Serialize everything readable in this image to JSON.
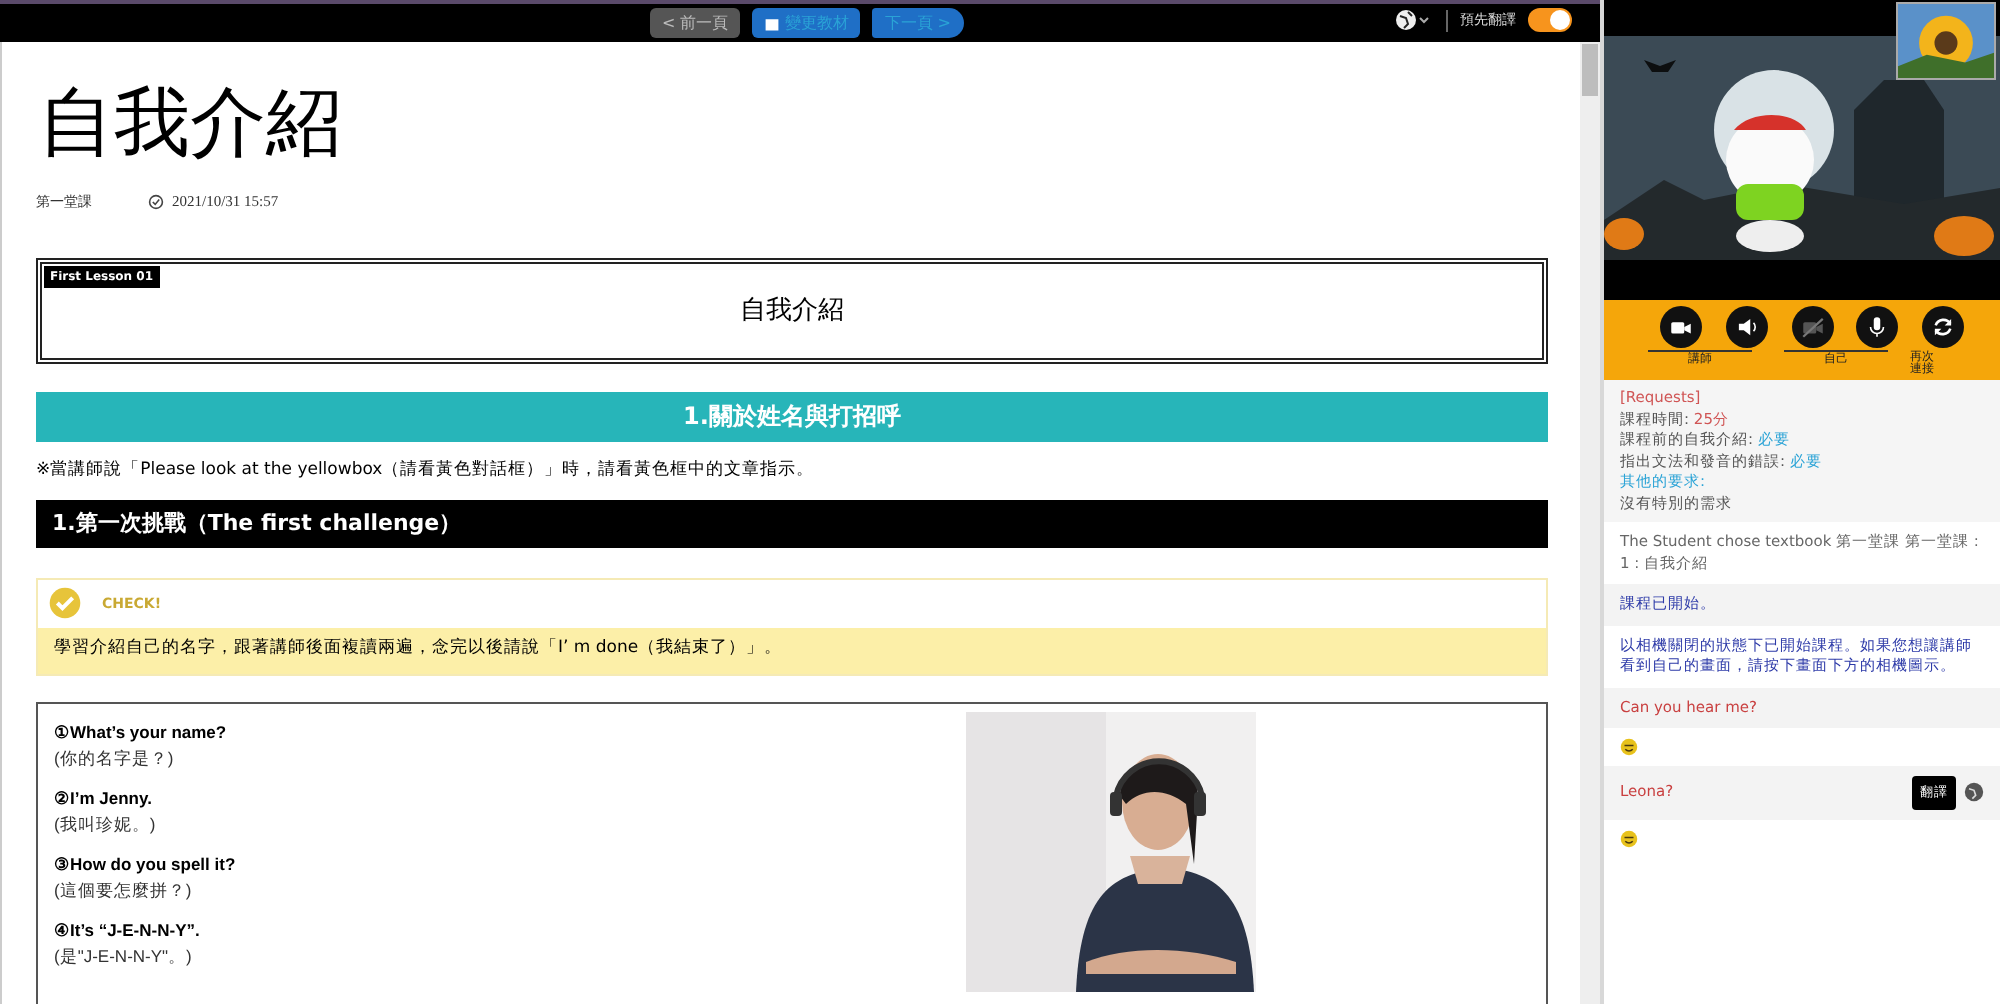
{
  "toolbar": {
    "prev_button": {
      "label": "< 前一頁",
      "disabled": true
    },
    "change_button": {
      "label": "變更教材"
    },
    "next_button": {
      "label": "下一頁 >"
    },
    "translate_toggle": {
      "label": "預先翻譯",
      "on": true
    }
  },
  "lesson": {
    "title": "自我介紹",
    "course": "第一堂課",
    "timestamp": "2021/10/31 15:57",
    "banner": {
      "tag": "First Lesson 01",
      "title": "自我介紹"
    },
    "section_title": "1.關於姓名與打招呼",
    "note": "※當講師說「Please look at the yellowbox（請看黃色對話框）」時，請看黃色框中的文章指示。",
    "challenge_title": "1.第一次挑戰（The first challenge）",
    "check": {
      "label": "CHECK!",
      "text": "學習介紹自己的名字，跟著講師後面複讀兩遍，念完以後請說「I’ m done（我結束了）」。"
    },
    "dialogue": [
      {
        "english": "①What’s your name?",
        "chinese": "(你的名字是？)"
      },
      {
        "english": "②I’m Jenny.",
        "chinese": "(我叫珍妮。)"
      },
      {
        "english": "③How do you spell it?",
        "chinese": "(這個要怎麼拼？)"
      },
      {
        "english": "④It’s “J-E-N-N-Y”.",
        "chinese": "(是\"J-E-N-N-Y\"。)"
      }
    ]
  },
  "controls": [
    {
      "kind": "camera"
    },
    {
      "kind": "speaker"
    },
    {
      "kind": "camera-off"
    },
    {
      "kind": "mic"
    },
    {
      "kind": "refresh"
    }
  ],
  "control_groups": [
    {
      "label": "講師"
    },
    {
      "label": "自己"
    },
    {
      "label": "再次連接"
    }
  ],
  "requests": {
    "title": "[Requests]",
    "items": [
      {
        "label": "課程時間: ",
        "value": "25分",
        "kind": "time"
      },
      {
        "label": "課程前的自我介紹: ",
        "value": "必要",
        "kind": "option"
      },
      {
        "label": "指出文法和發音的錯誤: ",
        "value": "必要",
        "kind": "option"
      }
    ],
    "other_label": "其他的要求:",
    "other_value": "沒有特別的需求"
  },
  "messages": [
    {
      "kind": "log",
      "text": "The Student chose textbook 第一堂課 第一堂課 : 1 : 自我介紹"
    },
    {
      "kind": "system",
      "text": "課程已開始。"
    },
    {
      "kind": "system",
      "text": "以相機關閉的狀態下已開始課程。如果您想讓講師看到自己的畫面，請按下畫面下方的相機圖示。"
    },
    {
      "kind": "chat",
      "text": "Can you hear me?"
    },
    {
      "kind": "emoji"
    },
    {
      "kind": "chat",
      "text": "Leona?",
      "tooltip": "翻譯"
    },
    {
      "kind": "emoji"
    }
  ]
}
